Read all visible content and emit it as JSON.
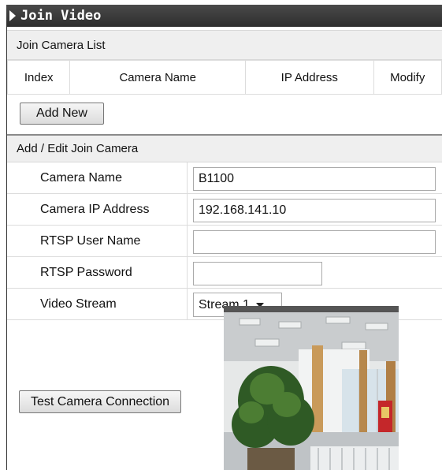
{
  "panel": {
    "title": "Join Video"
  },
  "join_list": {
    "title": "Join Camera List",
    "columns": [
      "Index",
      "Camera Name",
      "IP Address",
      "Modify"
    ],
    "add_button": "Add New"
  },
  "edit": {
    "title": "Add / Edit Join Camera",
    "fields": [
      {
        "label": "Camera Name",
        "value": "B1100"
      },
      {
        "label": "Camera IP Address",
        "value": "192.168.141.10"
      },
      {
        "label": "RTSP User Name",
        "value": ""
      },
      {
        "label": "RTSP Password",
        "value": ""
      },
      {
        "label": "Video Stream",
        "value": "Stream 1"
      }
    ],
    "stream_options": [
      "Stream 1"
    ],
    "test_button": "Test Camera Connection"
  },
  "colors": {
    "header_bg": "#333333",
    "section_bg": "#efefef"
  },
  "icons": [
    "play-triangle-icon",
    "dropdown-caret-icon"
  ]
}
